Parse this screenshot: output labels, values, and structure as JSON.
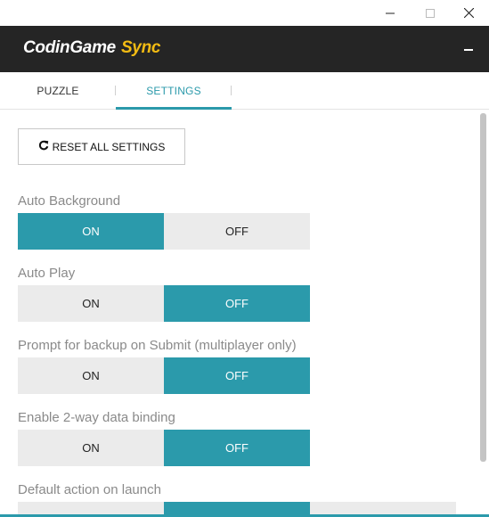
{
  "window": {
    "minimize_icon": "minimize-icon",
    "maximize_icon": "maximize-icon",
    "close_icon": "close-icon"
  },
  "header": {
    "logo_part1": "CodinGame",
    "logo_part2": "Sync",
    "collapse_icon": "minus-icon"
  },
  "tabs": [
    {
      "label": "PUZZLE",
      "active": false
    },
    {
      "label": "SETTINGS",
      "active": true
    }
  ],
  "settings": {
    "reset_label": "RESET ALL SETTINGS",
    "reset_icon": "refresh-icon",
    "items": [
      {
        "label": "Auto Background",
        "on": "ON",
        "off": "OFF",
        "value": "ON"
      },
      {
        "label": "Auto Play",
        "on": "ON",
        "off": "OFF",
        "value": "OFF"
      },
      {
        "label": "Prompt for backup on Submit (multiplayer only)",
        "on": "ON",
        "off": "OFF",
        "value": "OFF"
      },
      {
        "label": "Enable 2-way data binding",
        "on": "ON",
        "off": "OFF",
        "value": "OFF"
      },
      {
        "label": "Default action on launch"
      }
    ]
  },
  "colors": {
    "accent": "#2b9aab",
    "header_bg": "#252525",
    "logo_accent": "#f2bb13",
    "inactive_bg": "#ebebeb"
  }
}
